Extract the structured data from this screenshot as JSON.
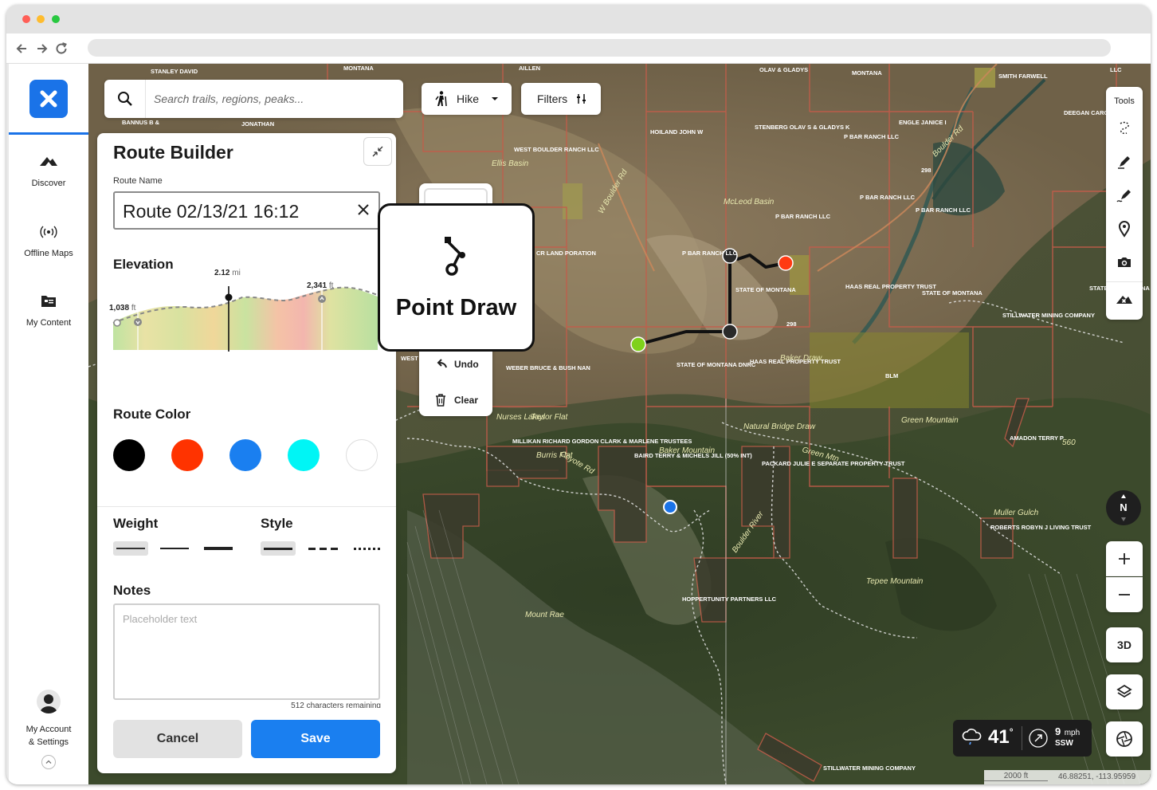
{
  "browser": {
    "traffic_colors": {
      "close": "#ff5f57",
      "minimize": "#febc2e",
      "maximize": "#28c840"
    }
  },
  "sidebar": {
    "items": [
      {
        "label": "Discover",
        "icon": "discover-icon"
      },
      {
        "label": "Offline Maps",
        "icon": "offline-maps-icon"
      },
      {
        "label": "My Content",
        "icon": "my-content-icon"
      }
    ],
    "account_line1": "My Account",
    "account_line2": "& Settings",
    "brand_color": "#1a73e8"
  },
  "search": {
    "placeholder": "Search trails, regions, peaks..."
  },
  "activity": {
    "label": "Hike"
  },
  "filters": {
    "label": "Filters"
  },
  "route_builder": {
    "title": "Route Builder",
    "route_name_label": "Route Name",
    "route_name_value": "Route 02/13/21 16:12",
    "elevation_label": "Elevation",
    "elevation": {
      "marker_distance_num": "2.12",
      "marker_distance_unit": "mi",
      "start_elev_num": "1,038",
      "start_elev_unit": "ft",
      "end_elev_num": "2,341",
      "end_elev_unit": "ft"
    },
    "route_color_label": "Route Color",
    "colors": [
      "#000000",
      "#ff3300",
      "#1a7ff0",
      "#00f5f5",
      "#ffffff"
    ],
    "weight_label": "Weight",
    "style_label": "Style",
    "notes_label": "Notes",
    "notes_placeholder": "Placeholder text",
    "chars_remaining": "512 characters remaining",
    "cancel_label": "Cancel",
    "save_label": "Save"
  },
  "draw_tools": {
    "tooltip_title": "Point Draw",
    "undo_label": "Undo",
    "clear_label": "Clear"
  },
  "map_tools": {
    "header": "Tools",
    "three_d_label": "3D",
    "compass_letter": "N"
  },
  "weather": {
    "temp": "41",
    "degree": "°",
    "wind_speed": "9",
    "wind_unit": "mph",
    "wind_dir": "SSW"
  },
  "scale": {
    "distance": "2000 ft",
    "coords": "46.88251, -113.95959"
  },
  "map_labels": {
    "ownership": [
      "STANLEY DAVID",
      "MONTANA",
      "AILLEN",
      "OLAV & GLADYS",
      "MONTANA",
      "SMITH FARWELL",
      "LLC",
      "BANNUS B &",
      "JONATHAN",
      "HOILAND JOHN W",
      "STENBERG OLAV S & GLADYS K",
      "P BAR RANCH LLC",
      "ENGLE JANICE I",
      "DEEGAN CAROL BETH",
      "WEST BOULDER RANCH LLC",
      "P BAR RANCH LLC",
      "P BAR RANCH LLC",
      "P BAR RANCH LLC",
      "CR LAND PORATION",
      "P BAR RANCH LLC",
      "STATE OF MONTANA",
      "HAAS REAL PROPERTY TRUST",
      "STATE OF MONTANA",
      "STATE OF MONTANA",
      "STILLWATER MINING COMPANY",
      "STATE OF MONTANA DNRC",
      "HAAS REAL PROPERTY TRUST",
      "BLM",
      "WEBER BRUCE & BUSH NAN",
      "MILLIKAN RICHARD GORDON CLARK & MARLENE TRUSTEES",
      "BAIRD TERRY & MICHELS JILL (50% INT)",
      "PACKARD JULIE E SEPARATE PROPERTY TRUST",
      "AMADON TERRY P",
      "ROBERTS ROBYN J LIVING TRUST",
      "HOPPERTUNITY PARTNERS LLC",
      "STILLWATER MINING COMPANY",
      "WEST OULD SERV ASSO INC"
    ],
    "places": [
      "Ellis Basin",
      "McLeod Basin",
      "Baker Draw",
      "Green Mountain",
      "Natural Bridge Draw",
      "Baker Mountain",
      "Taylor Flat",
      "Nurses Lakes",
      "Burris Flat",
      "Tepee Mountain",
      "Mount Rae",
      "Boulder River",
      "Green Mtn",
      "Muller Gulch",
      "560",
      "298",
      "298",
      "W Boulder Rd",
      "Boulder Rd",
      "Coyote Rd"
    ]
  }
}
